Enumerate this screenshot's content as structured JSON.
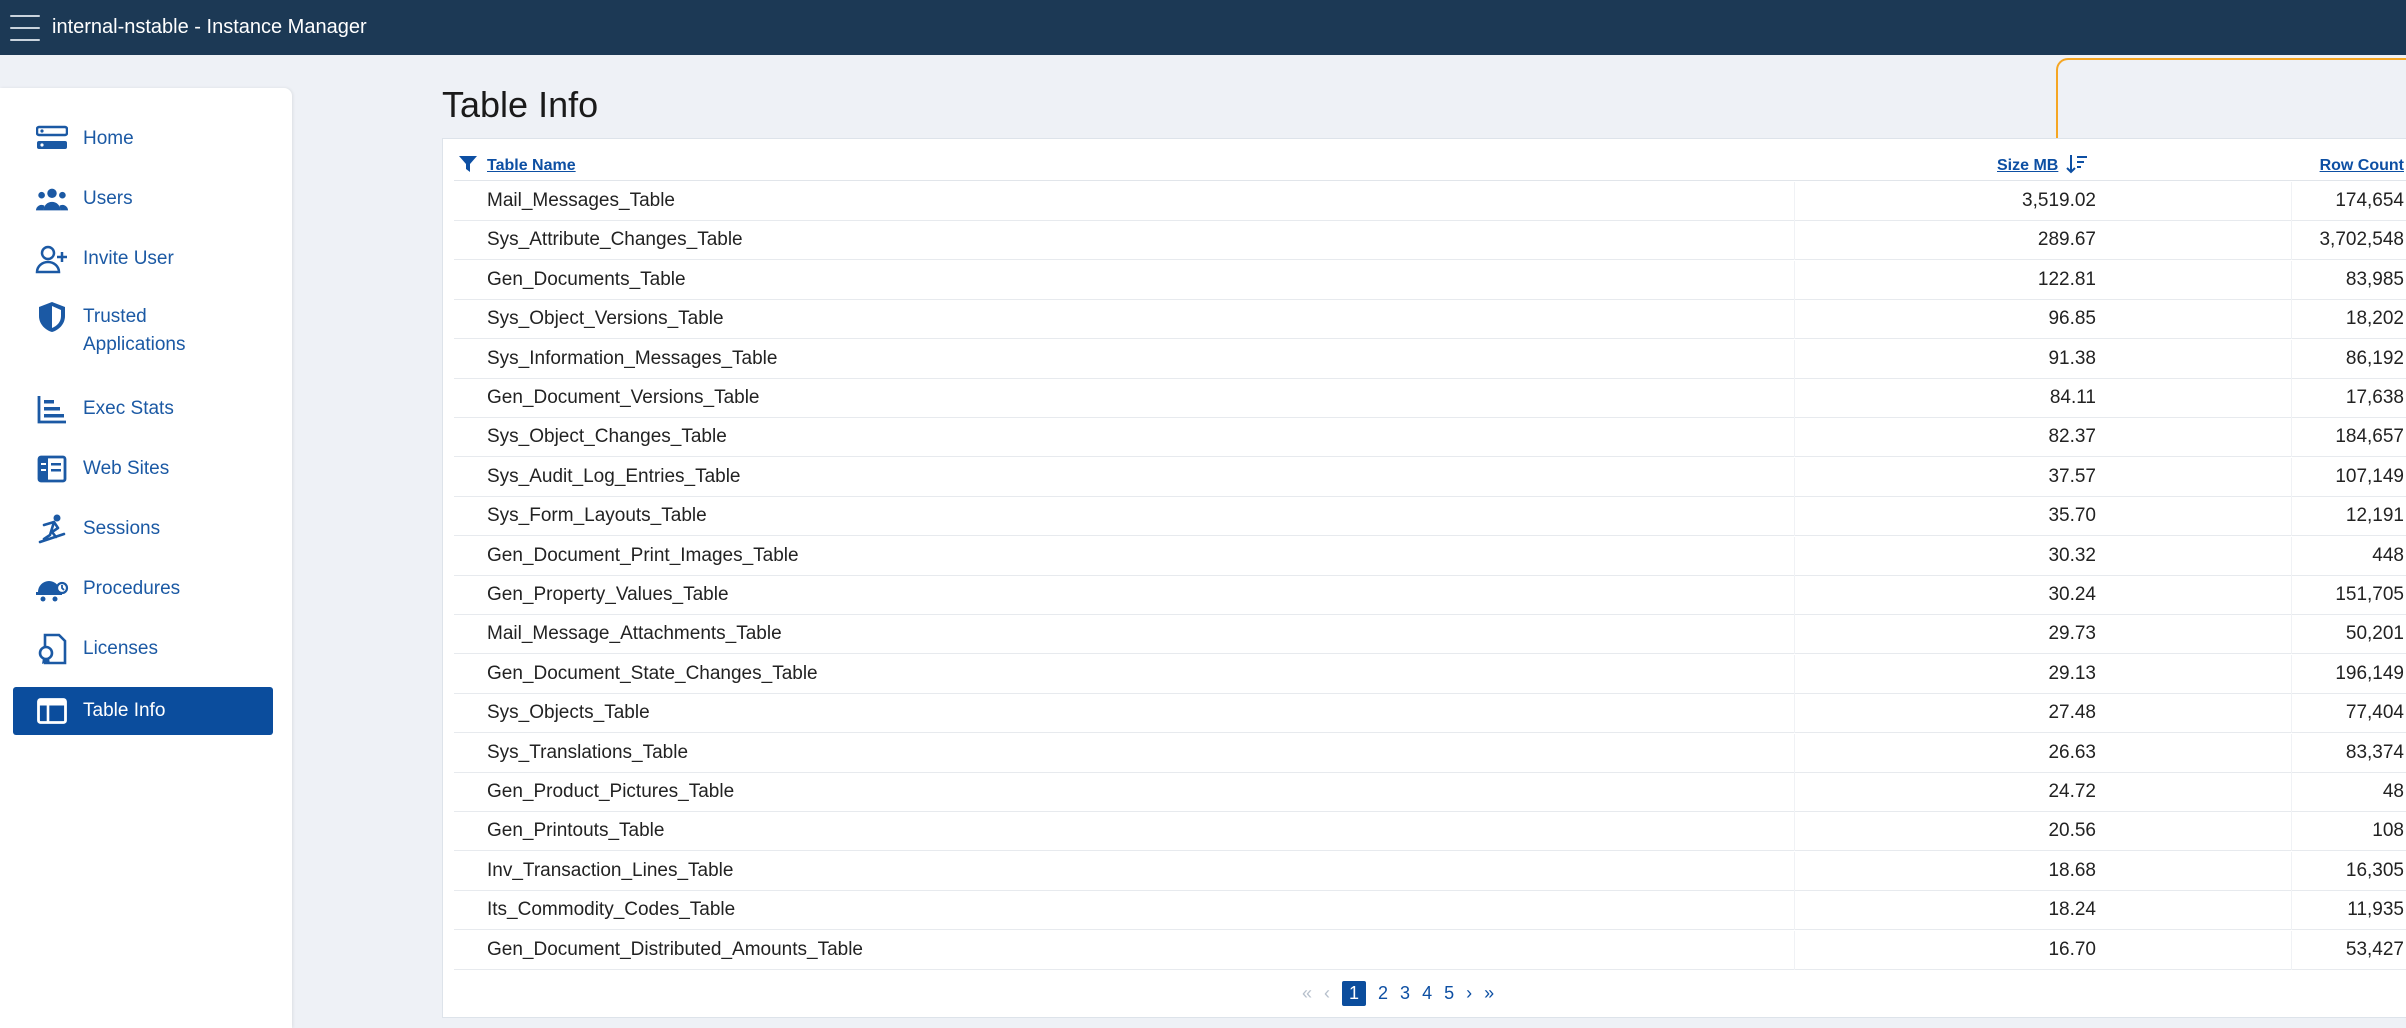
{
  "header": {
    "app_title": "internal-nstable - Instance Manager"
  },
  "sidebar": {
    "items": [
      {
        "label": "Home",
        "icon": "home-icon"
      },
      {
        "label": "Users",
        "icon": "users-icon"
      },
      {
        "label": "Invite User",
        "icon": "invite-user-icon"
      },
      {
        "label": "Trusted Applications",
        "icon": "shield-icon"
      },
      {
        "label": "Exec Stats",
        "icon": "bar-chart-icon"
      },
      {
        "label": "Web Sites",
        "icon": "web-sites-icon"
      },
      {
        "label": "Sessions",
        "icon": "sessions-icon"
      },
      {
        "label": "Procedures",
        "icon": "procedures-icon"
      },
      {
        "label": "Licenses",
        "icon": "licenses-icon"
      },
      {
        "label": "Table Info",
        "icon": "table-icon",
        "active": true
      }
    ]
  },
  "main": {
    "title": "Table Info",
    "columns": {
      "name": "Table Name",
      "size": "Size MB",
      "count": "Row Count"
    },
    "rows": [
      {
        "name": "Mail_Messages_Table",
        "size": "3,519.02",
        "count": "174,654"
      },
      {
        "name": "Sys_Attribute_Changes_Table",
        "size": "289.67",
        "count": "3,702,548"
      },
      {
        "name": "Gen_Documents_Table",
        "size": "122.81",
        "count": "83,985"
      },
      {
        "name": "Sys_Object_Versions_Table",
        "size": "96.85",
        "count": "18,202"
      },
      {
        "name": "Sys_Information_Messages_Table",
        "size": "91.38",
        "count": "86,192"
      },
      {
        "name": "Gen_Document_Versions_Table",
        "size": "84.11",
        "count": "17,638"
      },
      {
        "name": "Sys_Object_Changes_Table",
        "size": "82.37",
        "count": "184,657"
      },
      {
        "name": "Sys_Audit_Log_Entries_Table",
        "size": "37.57",
        "count": "107,149"
      },
      {
        "name": "Sys_Form_Layouts_Table",
        "size": "35.70",
        "count": "12,191"
      },
      {
        "name": "Gen_Document_Print_Images_Table",
        "size": "30.32",
        "count": "448"
      },
      {
        "name": "Gen_Property_Values_Table",
        "size": "30.24",
        "count": "151,705"
      },
      {
        "name": "Mail_Message_Attachments_Table",
        "size": "29.73",
        "count": "50,201"
      },
      {
        "name": "Gen_Document_State_Changes_Table",
        "size": "29.13",
        "count": "196,149"
      },
      {
        "name": "Sys_Objects_Table",
        "size": "27.48",
        "count": "77,404"
      },
      {
        "name": "Sys_Translations_Table",
        "size": "26.63",
        "count": "83,374"
      },
      {
        "name": "Gen_Product_Pictures_Table",
        "size": "24.72",
        "count": "48"
      },
      {
        "name": "Gen_Printouts_Table",
        "size": "20.56",
        "count": "108"
      },
      {
        "name": "Inv_Transaction_Lines_Table",
        "size": "18.68",
        "count": "16,305"
      },
      {
        "name": "Its_Commodity_Codes_Table",
        "size": "18.24",
        "count": "11,935"
      },
      {
        "name": "Gen_Document_Distributed_Amounts_Table",
        "size": "16.70",
        "count": "53,427"
      }
    ],
    "pagination": {
      "first": "«",
      "prev": "‹",
      "pages": [
        "1",
        "2",
        "3",
        "4",
        "5"
      ],
      "current": "1",
      "next": "›",
      "last": "»"
    }
  },
  "colors": {
    "topbar": "#1c3955",
    "accent": "#0b4d9d",
    "link": "#1b59a4",
    "highlight": "#f5a623"
  }
}
